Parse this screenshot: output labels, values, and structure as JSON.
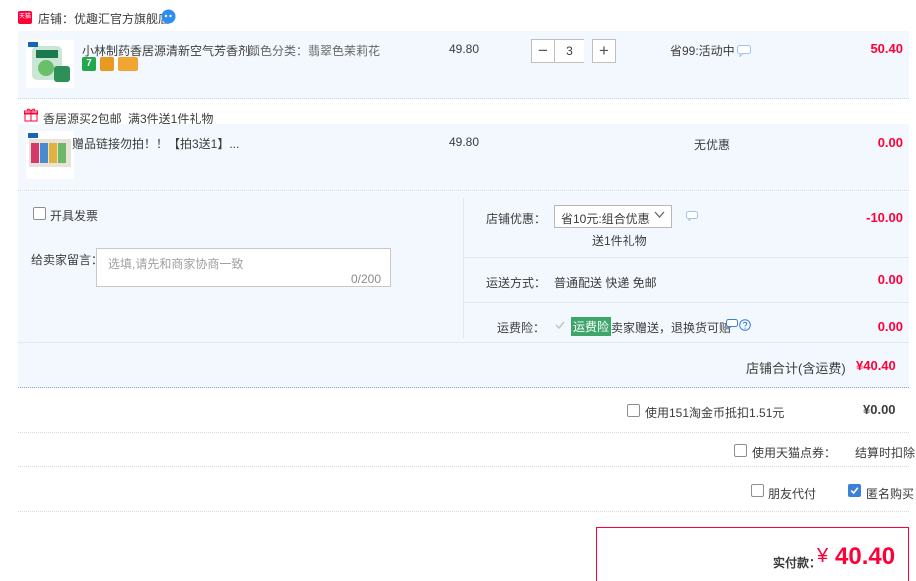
{
  "shop": {
    "badge": "天猫",
    "name": "店铺：优趣汇官方旗舰店"
  },
  "items": [
    {
      "title": "小林制药香居源清新空气芳香剂...",
      "sku": "颜色分类：翡翠色茉莉花",
      "price": "49.80",
      "qty": "3",
      "promo": "省99:活动中",
      "subtotal": "50.40"
    },
    {
      "title": "赠品链接勿拍！！【拍3送1】...",
      "price": "49.80",
      "promo": "无优惠",
      "subtotal": "0.00"
    }
  ],
  "gift_bar": {
    "tag": "香居源买2包邮",
    "desc": "满3件送1件礼物"
  },
  "options": {
    "invoice_label": "开具发票",
    "message_label": "给卖家留言：",
    "message_placeholder": "选填,请先和商家协商一致",
    "message_counter": "0/200",
    "shop_discount_label": "店铺优惠：",
    "shop_discount_value": "省10元:组合优惠",
    "shop_discount_note": "送1件礼物",
    "shop_discount_amount": "-10.00",
    "shipping_label": "运送方式：",
    "shipping_value": "普通配送 快递 免邮",
    "shipping_amount": "0.00",
    "freight_ins_label": "运费险：",
    "freight_ins_badge": "运费险",
    "freight_ins_value": "卖家赠送，退换货可赔",
    "freight_ins_amount": "0.00",
    "shop_total_label": "店铺合计(含运费)",
    "shop_total_value": "¥40.40"
  },
  "summary": {
    "coin_label": "使用151淘金币抵扣1.51元",
    "coin_value": "¥0.00",
    "coupon_label": "使用天猫点券：",
    "coupon_value": "结算时扣除",
    "friend_pay_label": "朋友代付",
    "anonymous_label": "匿名购买",
    "actual_label": "实付款：",
    "currency": "¥",
    "actual_value": "40.40"
  },
  "colors": {
    "accent_red": "#ff0036",
    "panel_bg": "#f3f8fe",
    "check_blue": "#3b7fd6",
    "freight_green": "#3fa66b"
  }
}
